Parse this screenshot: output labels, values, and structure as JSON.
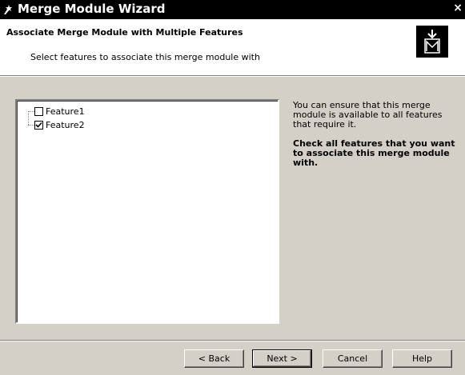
{
  "window": {
    "title": "Merge Module Wizard",
    "close_glyph": "×"
  },
  "header": {
    "title": "Associate Merge Module with Multiple Features",
    "subtitle": "Select features to associate this merge module with",
    "logo_icon": "merge-module-logo-icon"
  },
  "tree": {
    "items": [
      {
        "label": "Feature1",
        "checked": false
      },
      {
        "label": "Feature2",
        "checked": true
      }
    ]
  },
  "info": {
    "text": "You can ensure that this merge module is available to all features that require it.",
    "bold_text": "Check all features that you want to associate this merge module with."
  },
  "buttons": {
    "back": "< Back",
    "next": "Next >",
    "cancel": "Cancel",
    "help": "Help"
  }
}
